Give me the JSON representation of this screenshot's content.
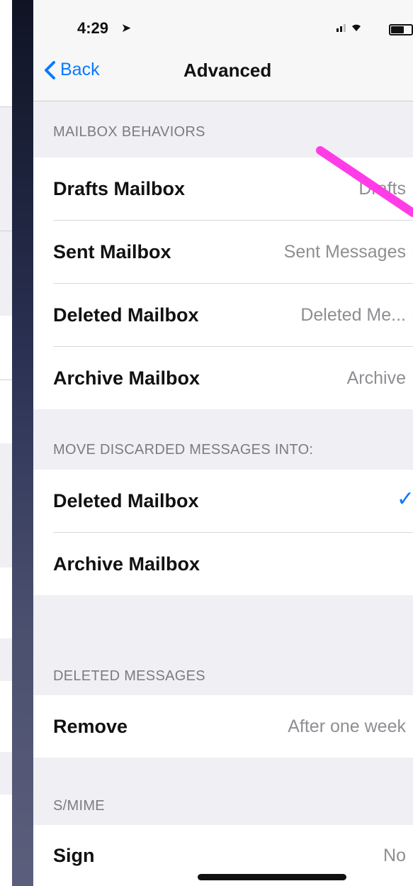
{
  "status_bar": {
    "time": "4:29",
    "location_icon": "location-arrow-icon"
  },
  "nav": {
    "back_label": "Back",
    "title": "Advanced"
  },
  "sections": {
    "mailbox_behaviors": {
      "header": "MAILBOX BEHAVIORS",
      "rows": [
        {
          "label": "Drafts Mailbox",
          "value": "Drafts"
        },
        {
          "label": "Sent Mailbox",
          "value": "Sent Messages"
        },
        {
          "label": "Deleted Mailbox",
          "value": "Deleted Me..."
        },
        {
          "label": "Archive Mailbox",
          "value": "Archive"
        }
      ]
    },
    "move_discarded": {
      "header": "MOVE DISCARDED MESSAGES INTO:",
      "rows": [
        {
          "label": "Deleted Mailbox",
          "checked": true
        },
        {
          "label": "Archive Mailbox",
          "checked": false
        }
      ]
    },
    "deleted_messages": {
      "header": "DELETED MESSAGES",
      "rows": [
        {
          "label": "Remove",
          "value": "After one week"
        }
      ]
    },
    "smime": {
      "header": "S/MIME",
      "rows": [
        {
          "label": "Sign",
          "value": "No"
        }
      ]
    }
  },
  "colors": {
    "accent": "#0a7aff",
    "annotation": "#ff3ce6",
    "group_bg": "#ffffff",
    "page_bg": "#efeff4"
  }
}
